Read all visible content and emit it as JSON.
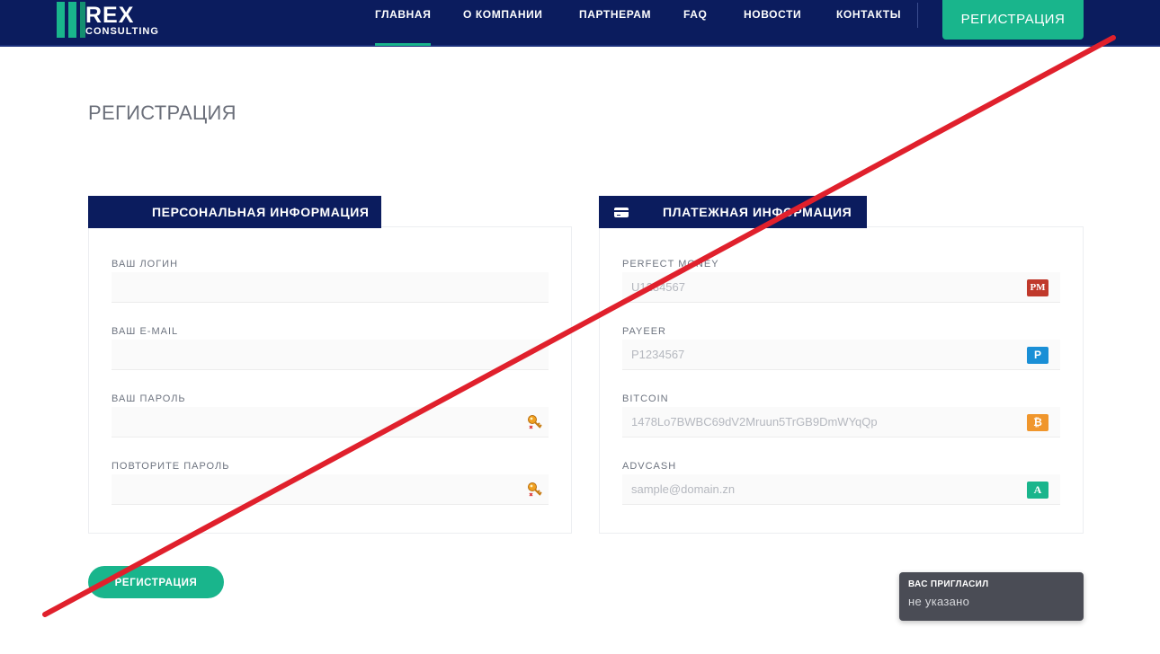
{
  "brand": {
    "name_line1": "REX",
    "name_line2": "CONSULTING",
    "accent_color": "#19b58c",
    "header_color": "#0b1c5e"
  },
  "nav": {
    "items": [
      {
        "label": "ГЛАВНАЯ",
        "active": true
      },
      {
        "label": "О КОМПАНИИ",
        "active": false
      },
      {
        "label": "ПАРТНЕРАМ",
        "active": false
      },
      {
        "label": "FAQ",
        "active": false
      },
      {
        "label": "НОВОСТИ",
        "active": false
      },
      {
        "label": "КОНТАКТЫ",
        "active": false
      }
    ],
    "register_button": "РЕГИСТРАЦИЯ"
  },
  "page": {
    "title": "РЕГИСТРАЦИЯ"
  },
  "personal": {
    "tab_label": "ПЕРСОНАЛЬНАЯ ИНФОРМАЦИЯ",
    "fields": [
      {
        "label": "ВАШ ЛОГИН",
        "value": "",
        "placeholder": ""
      },
      {
        "label": "ВАШ E-MAIL",
        "value": "",
        "placeholder": ""
      },
      {
        "label": "ВАШ ПАРОЛЬ",
        "value": "",
        "placeholder": "",
        "icon": "key-icon"
      },
      {
        "label": "ПОВТОРИТЕ ПАРОЛЬ",
        "value": "",
        "placeholder": "",
        "icon": "key-icon"
      }
    ]
  },
  "payment": {
    "tab_label": "ПЛАТЕЖНАЯ ИНФОРМАЦИЯ",
    "tab_icon": "credit-card-icon",
    "fields": [
      {
        "label": "PERFECT MONEY",
        "placeholder": "U1234567",
        "icon": "perfect-money-icon",
        "badge": "PM",
        "color": "#c0392b"
      },
      {
        "label": "PAYEER",
        "placeholder": "P1234567",
        "icon": "payeer-icon",
        "badge": "P",
        "color": "#1a8fd6"
      },
      {
        "label": "BITCOIN",
        "placeholder": "1478Lo7BWBC69dV2Mruun5TrGB9DmWYqQp",
        "icon": "bitcoin-icon",
        "badge": "₿",
        "color": "#f0962c"
      },
      {
        "label": "ADVCASH",
        "placeholder": "sample@domain.zn",
        "icon": "advcash-icon",
        "badge": "A",
        "color": "#19b58c"
      }
    ]
  },
  "submit": {
    "label": "РЕГИСТРАЦИЯ"
  },
  "inviter": {
    "title": "ВАС ПРИГЛАСИЛ",
    "value": "не указано"
  },
  "overlay": {
    "strike_color": "#e0202c"
  }
}
